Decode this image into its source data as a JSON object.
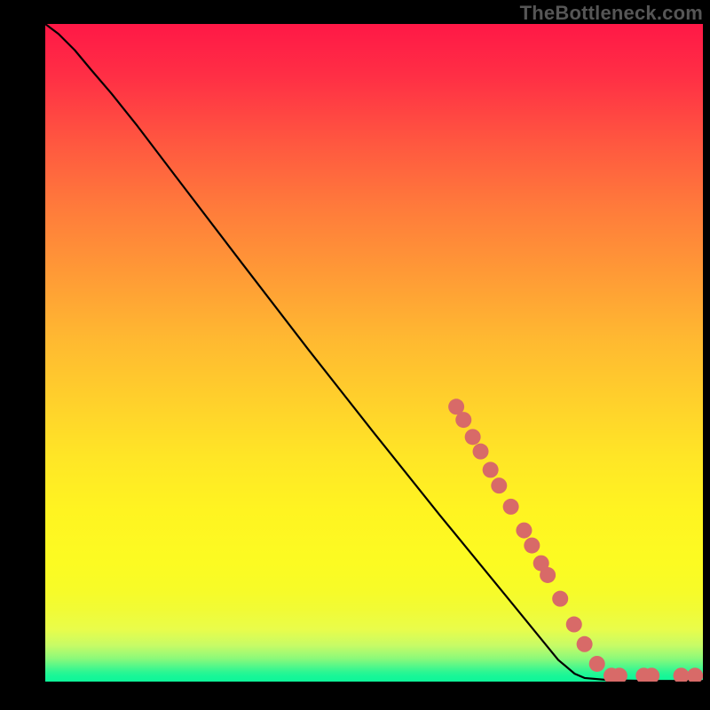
{
  "watermark": {
    "text": "TheBottleneck.com"
  },
  "chart_data": {
    "type": "line",
    "title": "",
    "xlabel": "",
    "ylabel": "",
    "xlim": [
      0,
      100
    ],
    "ylim": [
      0,
      100
    ],
    "grid": false,
    "background": "rainbow-vertical-gradient",
    "series": [
      {
        "name": "curve",
        "color": "#000000",
        "points": [
          {
            "x": 0.0,
            "y": 100.0
          },
          {
            "x": 2.0,
            "y": 98.5
          },
          {
            "x": 4.5,
            "y": 96.0
          },
          {
            "x": 7.0,
            "y": 93.0
          },
          {
            "x": 10.0,
            "y": 89.5
          },
          {
            "x": 14.0,
            "y": 84.5
          },
          {
            "x": 20.0,
            "y": 76.6
          },
          {
            "x": 30.0,
            "y": 63.5
          },
          {
            "x": 40.0,
            "y": 50.5
          },
          {
            "x": 50.0,
            "y": 37.8
          },
          {
            "x": 60.0,
            "y": 25.3
          },
          {
            "x": 70.0,
            "y": 13.1
          },
          {
            "x": 78.0,
            "y": 3.3
          },
          {
            "x": 80.5,
            "y": 1.2
          },
          {
            "x": 82.0,
            "y": 0.55
          },
          {
            "x": 86.0,
            "y": 0.2
          },
          {
            "x": 92.0,
            "y": 0.1
          },
          {
            "x": 100.0,
            "y": 0.1
          }
        ]
      }
    ],
    "markers": {
      "name": "thick-segment-markers",
      "color": "#d86a68",
      "radius_px": 9,
      "points": [
        {
          "x": 62.5,
          "y": 41.8
        },
        {
          "x": 63.6,
          "y": 39.8
        },
        {
          "x": 65.0,
          "y": 37.2
        },
        {
          "x": 66.2,
          "y": 35.0
        },
        {
          "x": 67.7,
          "y": 32.2
        },
        {
          "x": 69.0,
          "y": 29.8
        },
        {
          "x": 70.8,
          "y": 26.6
        },
        {
          "x": 72.8,
          "y": 23.0
        },
        {
          "x": 74.0,
          "y": 20.7
        },
        {
          "x": 75.4,
          "y": 18.0
        },
        {
          "x": 76.4,
          "y": 16.2
        },
        {
          "x": 78.3,
          "y": 12.6
        },
        {
          "x": 80.4,
          "y": 8.7
        },
        {
          "x": 82.0,
          "y": 5.7
        },
        {
          "x": 83.9,
          "y": 2.7
        },
        {
          "x": 86.1,
          "y": 0.9
        },
        {
          "x": 87.3,
          "y": 0.9
        },
        {
          "x": 91.0,
          "y": 0.9
        },
        {
          "x": 92.2,
          "y": 0.9
        },
        {
          "x": 96.7,
          "y": 0.9
        },
        {
          "x": 98.8,
          "y": 0.9
        }
      ]
    }
  }
}
